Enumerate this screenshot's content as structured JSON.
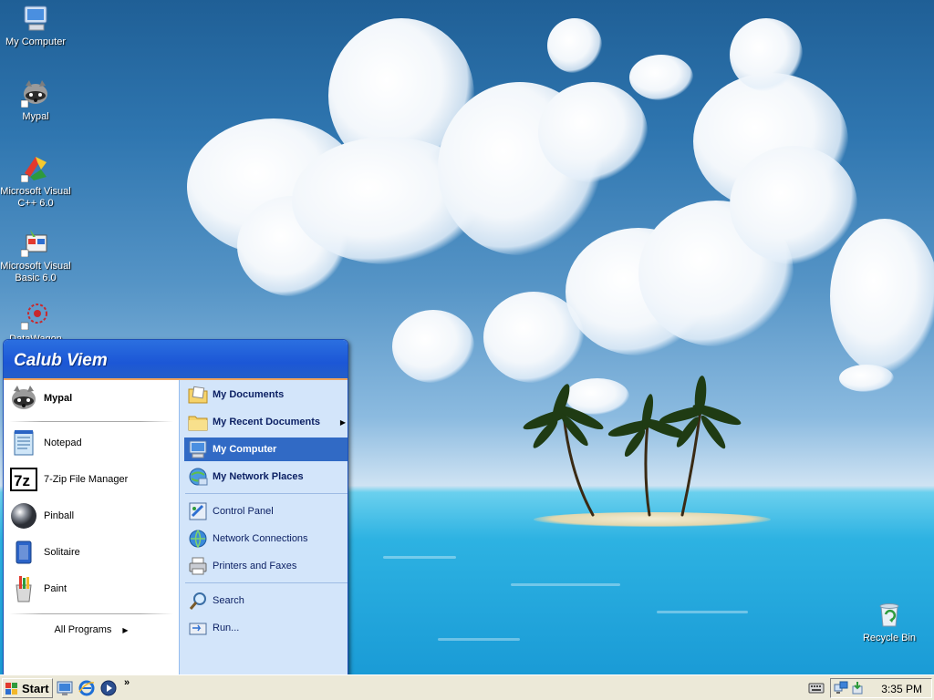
{
  "desktop": {
    "icons": [
      {
        "name": "my-computer",
        "label": "My Computer"
      },
      {
        "name": "mypal",
        "label": "Mypal"
      },
      {
        "name": "visual-cpp",
        "label": "Microsoft Visual C++ 6.0"
      },
      {
        "name": "visual-basic",
        "label": "Microsoft Visual Basic 6.0"
      },
      {
        "name": "datawagon",
        "label": "DataWagon"
      },
      {
        "name": "recycle-bin",
        "label": "Recycle Bin"
      }
    ]
  },
  "start_menu": {
    "user_name": "Calub Viem",
    "pinned": [
      {
        "label": "Mypal",
        "icon": "raccoon-icon"
      }
    ],
    "recent": [
      {
        "label": "Notepad",
        "icon": "notepad-icon"
      },
      {
        "label": "7-Zip File Manager",
        "icon": "7zip-icon"
      },
      {
        "label": "Pinball",
        "icon": "pinball-icon"
      },
      {
        "label": "Solitaire",
        "icon": "solitaire-icon"
      },
      {
        "label": "Paint",
        "icon": "paint-icon"
      }
    ],
    "all_programs": "All Programs",
    "places": [
      {
        "label": "My Documents",
        "icon": "documents-folder-icon"
      },
      {
        "label": "My Recent Documents",
        "icon": "recent-folder-icon",
        "submenu": true
      },
      {
        "label": "My Computer",
        "icon": "computer-icon",
        "highlighted": true
      },
      {
        "label": "My Network Places",
        "icon": "network-places-icon"
      }
    ],
    "settings": [
      {
        "label": "Control Panel",
        "icon": "control-panel-icon"
      },
      {
        "label": "Network Connections",
        "icon": "network-connections-icon"
      },
      {
        "label": "Printers and Faxes",
        "icon": "printer-icon"
      }
    ],
    "tools": [
      {
        "label": "Search",
        "icon": "search-icon"
      },
      {
        "label": "Run...",
        "icon": "run-icon"
      }
    ]
  },
  "taskbar": {
    "start_label": "Start",
    "quick_launch": [
      "show-desktop-icon",
      "internet-explorer-icon",
      "media-player-icon"
    ],
    "overflow_label": "»",
    "tray": [
      "keyboard-icon",
      "network-tray-icon",
      "safely-remove-icon"
    ],
    "clock": "3:35 PM"
  },
  "colors": {
    "menu_header": "#1c57d6",
    "menu_highlight": "#316ac5",
    "menu_right_pane": "#d3e5fa",
    "taskbar": "#ece9d8"
  }
}
